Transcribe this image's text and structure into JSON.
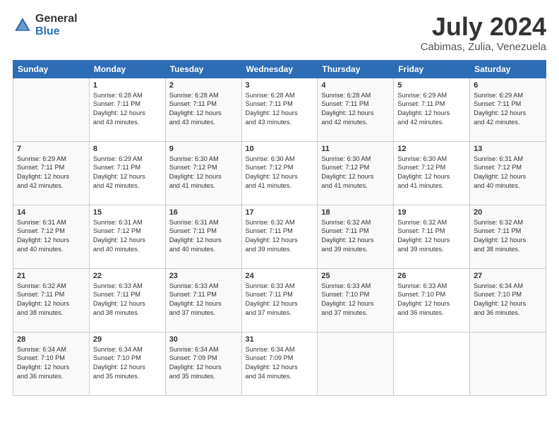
{
  "logo": {
    "general": "General",
    "blue": "Blue"
  },
  "title": "July 2024",
  "location": "Cabimas, Zulia, Venezuela",
  "days_header": [
    "Sunday",
    "Monday",
    "Tuesday",
    "Wednesday",
    "Thursday",
    "Friday",
    "Saturday"
  ],
  "weeks": [
    [
      {
        "day": "",
        "content": ""
      },
      {
        "day": "1",
        "content": "Sunrise: 6:28 AM\nSunset: 7:11 PM\nDaylight: 12 hours\nand 43 minutes."
      },
      {
        "day": "2",
        "content": "Sunrise: 6:28 AM\nSunset: 7:11 PM\nDaylight: 12 hours\nand 43 minutes."
      },
      {
        "day": "3",
        "content": "Sunrise: 6:28 AM\nSunset: 7:11 PM\nDaylight: 12 hours\nand 43 minutes."
      },
      {
        "day": "4",
        "content": "Sunrise: 6:28 AM\nSunset: 7:11 PM\nDaylight: 12 hours\nand 42 minutes."
      },
      {
        "day": "5",
        "content": "Sunrise: 6:29 AM\nSunset: 7:11 PM\nDaylight: 12 hours\nand 42 minutes."
      },
      {
        "day": "6",
        "content": "Sunrise: 6:29 AM\nSunset: 7:11 PM\nDaylight: 12 hours\nand 42 minutes."
      }
    ],
    [
      {
        "day": "7",
        "content": "Sunrise: 6:29 AM\nSunset: 7:11 PM\nDaylight: 12 hours\nand 42 minutes."
      },
      {
        "day": "8",
        "content": "Sunrise: 6:29 AM\nSunset: 7:11 PM\nDaylight: 12 hours\nand 42 minutes."
      },
      {
        "day": "9",
        "content": "Sunrise: 6:30 AM\nSunset: 7:12 PM\nDaylight: 12 hours\nand 41 minutes."
      },
      {
        "day": "10",
        "content": "Sunrise: 6:30 AM\nSunset: 7:12 PM\nDaylight: 12 hours\nand 41 minutes."
      },
      {
        "day": "11",
        "content": "Sunrise: 6:30 AM\nSunset: 7:12 PM\nDaylight: 12 hours\nand 41 minutes."
      },
      {
        "day": "12",
        "content": "Sunrise: 6:30 AM\nSunset: 7:12 PM\nDaylight: 12 hours\nand 41 minutes."
      },
      {
        "day": "13",
        "content": "Sunrise: 6:31 AM\nSunset: 7:12 PM\nDaylight: 12 hours\nand 40 minutes."
      }
    ],
    [
      {
        "day": "14",
        "content": "Sunrise: 6:31 AM\nSunset: 7:12 PM\nDaylight: 12 hours\nand 40 minutes."
      },
      {
        "day": "15",
        "content": "Sunrise: 6:31 AM\nSunset: 7:12 PM\nDaylight: 12 hours\nand 40 minutes."
      },
      {
        "day": "16",
        "content": "Sunrise: 6:31 AM\nSunset: 7:11 PM\nDaylight: 12 hours\nand 40 minutes."
      },
      {
        "day": "17",
        "content": "Sunrise: 6:32 AM\nSunset: 7:11 PM\nDaylight: 12 hours\nand 39 minutes."
      },
      {
        "day": "18",
        "content": "Sunrise: 6:32 AM\nSunset: 7:11 PM\nDaylight: 12 hours\nand 39 minutes."
      },
      {
        "day": "19",
        "content": "Sunrise: 6:32 AM\nSunset: 7:11 PM\nDaylight: 12 hours\nand 39 minutes."
      },
      {
        "day": "20",
        "content": "Sunrise: 6:32 AM\nSunset: 7:11 PM\nDaylight: 12 hours\nand 38 minutes."
      }
    ],
    [
      {
        "day": "21",
        "content": "Sunrise: 6:32 AM\nSunset: 7:11 PM\nDaylight: 12 hours\nand 38 minutes."
      },
      {
        "day": "22",
        "content": "Sunrise: 6:33 AM\nSunset: 7:11 PM\nDaylight: 12 hours\nand 38 minutes."
      },
      {
        "day": "23",
        "content": "Sunrise: 6:33 AM\nSunset: 7:11 PM\nDaylight: 12 hours\nand 37 minutes."
      },
      {
        "day": "24",
        "content": "Sunrise: 6:33 AM\nSunset: 7:11 PM\nDaylight: 12 hours\nand 37 minutes."
      },
      {
        "day": "25",
        "content": "Sunrise: 6:33 AM\nSunset: 7:10 PM\nDaylight: 12 hours\nand 37 minutes."
      },
      {
        "day": "26",
        "content": "Sunrise: 6:33 AM\nSunset: 7:10 PM\nDaylight: 12 hours\nand 36 minutes."
      },
      {
        "day": "27",
        "content": "Sunrise: 6:34 AM\nSunset: 7:10 PM\nDaylight: 12 hours\nand 36 minutes."
      }
    ],
    [
      {
        "day": "28",
        "content": "Sunrise: 6:34 AM\nSunset: 7:10 PM\nDaylight: 12 hours\nand 36 minutes."
      },
      {
        "day": "29",
        "content": "Sunrise: 6:34 AM\nSunset: 7:10 PM\nDaylight: 12 hours\nand 35 minutes."
      },
      {
        "day": "30",
        "content": "Sunrise: 6:34 AM\nSunset: 7:09 PM\nDaylight: 12 hours\nand 35 minutes."
      },
      {
        "day": "31",
        "content": "Sunrise: 6:34 AM\nSunset: 7:09 PM\nDaylight: 12 hours\nand 34 minutes."
      },
      {
        "day": "",
        "content": ""
      },
      {
        "day": "",
        "content": ""
      },
      {
        "day": "",
        "content": ""
      }
    ]
  ]
}
